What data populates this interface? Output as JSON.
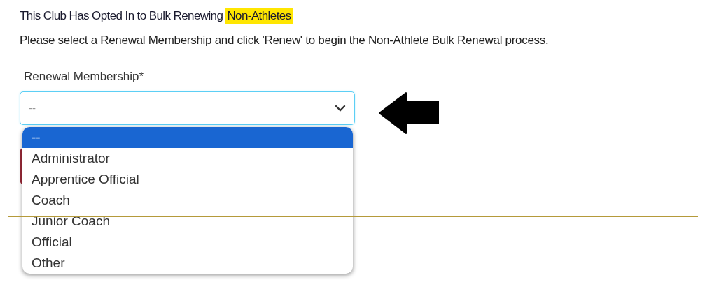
{
  "heading": {
    "text": "This Club Has Opted In to Bulk Renewing",
    "highlight": "Non-Athletes"
  },
  "instructions": "Please select a Renewal Membership and click 'Renew' to begin the Non-Athlete Bulk Renewal process.",
  "renewal_membership": {
    "label": "Renewal Membership*",
    "value": "--",
    "expanded": true,
    "options": [
      {
        "label": "--",
        "selected": true
      },
      {
        "label": "Administrator",
        "selected": false
      },
      {
        "label": "Apprentice Official",
        "selected": false
      },
      {
        "label": "Coach",
        "selected": false
      },
      {
        "label": "Junior Coach",
        "selected": false
      },
      {
        "label": "Official",
        "selected": false
      },
      {
        "label": "Other",
        "selected": false
      }
    ]
  }
}
